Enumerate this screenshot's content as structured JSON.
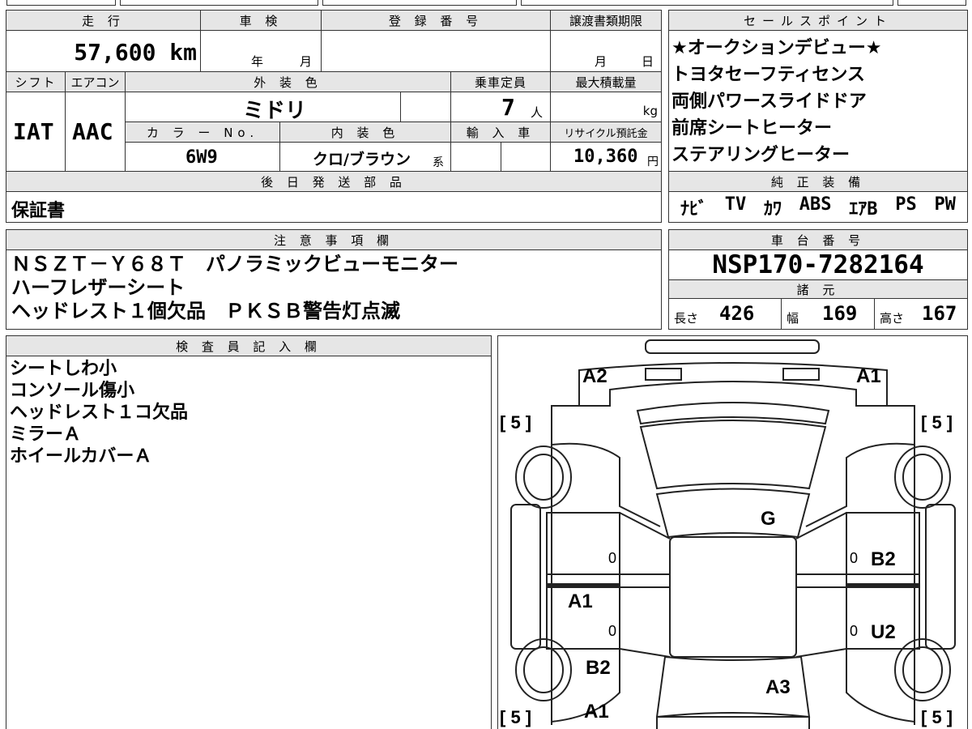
{
  "headers": {
    "mileage": "走 行",
    "inspection": "車 検",
    "registration": "登 録 番 号",
    "transfer_deadline": "譲渡書類期限",
    "sales_points": "セールスポイント",
    "shift": "シフト",
    "aircon": "エアコン",
    "exterior_color": "外 装 色",
    "capacity": "乗車定員",
    "max_load": "最大積載量",
    "color_no": "カ ラ ー No.",
    "interior_color": "内 装 色",
    "import": "輸 入 車",
    "recycle_fee": "リサイクル預託金",
    "later_parts": "後 日 発 送 部 品",
    "genuine_equipment": "純 正 装 備",
    "notes": "注 意 事 項 欄",
    "chassis_no": "車 台 番 号",
    "specs": "諸 元",
    "inspector_notes": "検 査 員 記 入 欄"
  },
  "vehicle": {
    "mileage": "57,600 km",
    "inspection_year_unit": "年",
    "inspection_month_unit": "月",
    "transfer_month_unit": "月",
    "transfer_day_unit": "日",
    "shift": "IAT",
    "aircon": "AAC",
    "exterior_color": "ミドリ",
    "capacity": "7",
    "capacity_unit": "人",
    "load_unit": "kg",
    "color_no": "6W9",
    "interior_color": "クロ/ブラウン",
    "interior_suffix": "系",
    "recycle_fee": "10,360",
    "recycle_unit": "円",
    "later_parts": "保証書",
    "chassis_no": "NSP170-7282164",
    "length_label": "長さ",
    "length": "426",
    "width_label": "幅",
    "width": "169",
    "height_label": "高さ",
    "height": "167"
  },
  "sales_points": [
    "★オークションデビュー★",
    "トヨタセーフティセンス",
    "両側パワースライドドア",
    "前席シートヒーター",
    "ステアリングヒーター"
  ],
  "genuine_equipment": [
    "ﾅﾋﾞ",
    "TV",
    "ｶﾜ",
    "ABS",
    "ｴｱB",
    "PS",
    "PW"
  ],
  "notes": [
    "ＮＳＺＴ－Ｙ６８Ｔ　パノラミックビューモニター",
    "ハーフレザーシート",
    "ヘッドレスト１個欠品　ＰＫＳＢ警告灯点滅"
  ],
  "inspector_notes": [
    "シートしわ小",
    "コンソール傷小",
    "ヘッドレスト１コ欠品",
    "ミラーＡ",
    "ホイールカバーＡ"
  ],
  "diagram": {
    "front_left": "A2",
    "front_right": "A1",
    "roof": "G",
    "right_front_door": "B2",
    "left_rear_door": "A1",
    "right_rear_door": "U2",
    "left_rear_quarter": "B2",
    "rear": "A3",
    "left_rear_bottom": "A1",
    "tire_fl": "[ 5 ]",
    "tire_fr": "[ 5 ]",
    "tire_rl": "[ 5 ]",
    "tire_rr": "[ 5 ]",
    "zero_mark": "0"
  }
}
